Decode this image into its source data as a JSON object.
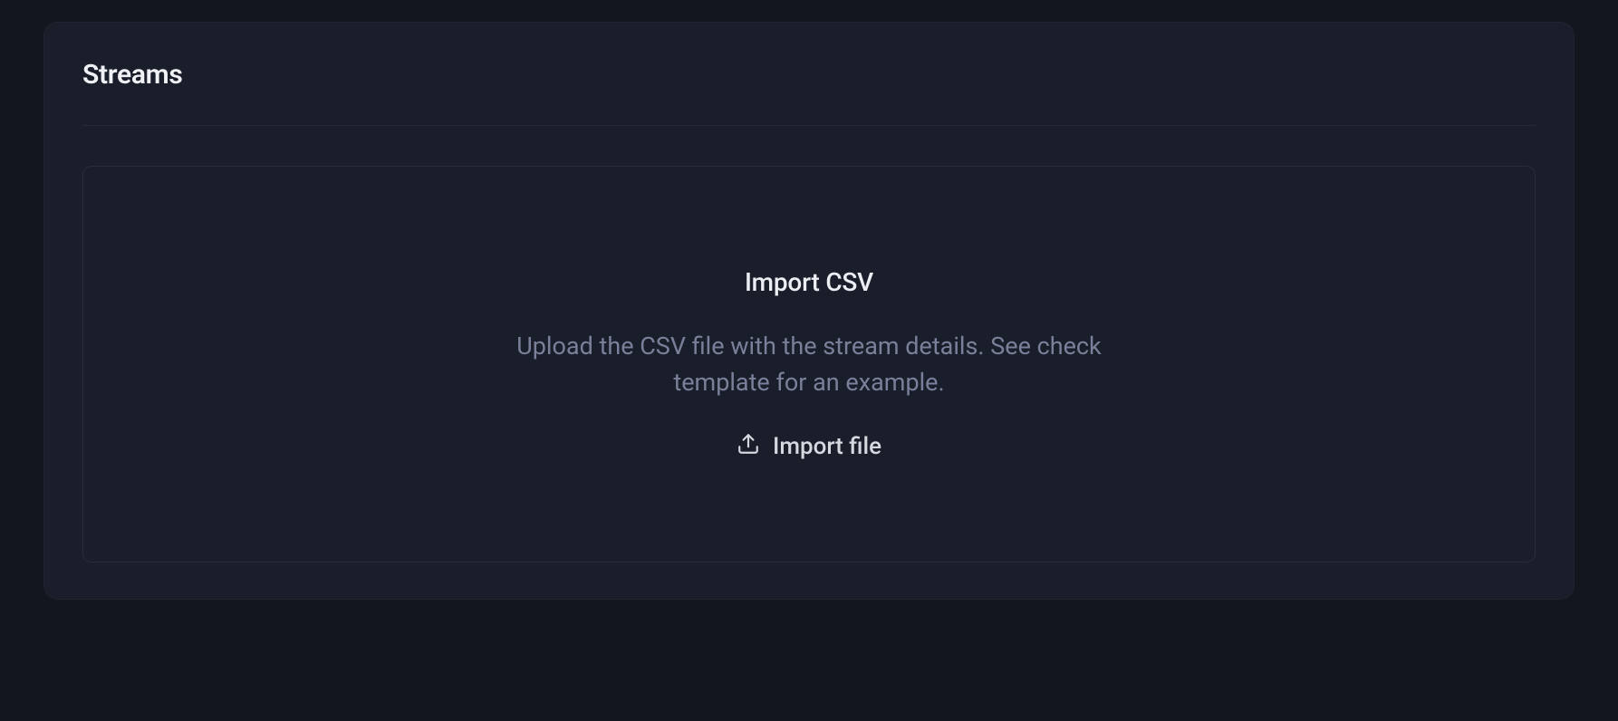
{
  "panel": {
    "title": "Streams"
  },
  "dropzone": {
    "title": "Import CSV",
    "description": "Upload the CSV file with the stream details. See check template for an example.",
    "button_label": "Import file"
  }
}
